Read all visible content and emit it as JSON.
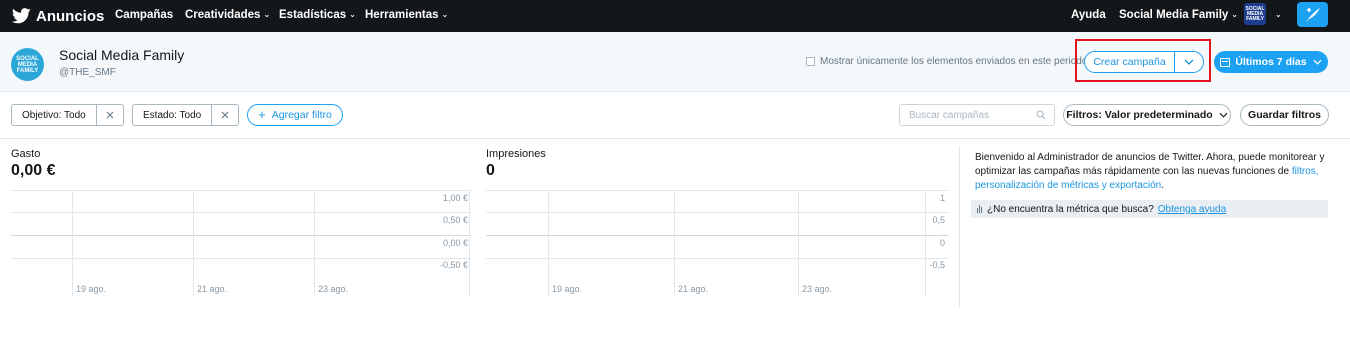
{
  "topnav": {
    "brand": "Anuncios",
    "items": [
      {
        "label": "Campañas",
        "dropdown": false
      },
      {
        "label": "Creatividades",
        "dropdown": true
      },
      {
        "label": "Estadísticas",
        "dropdown": true
      },
      {
        "label": "Herramientas",
        "dropdown": true
      }
    ],
    "help": "Ayuda",
    "account": "Social Media Family",
    "avatar_text": "SOCIAL MEDIA FAMILY",
    "colors": {
      "background": "#14171a",
      "accent": "#1da1f2"
    }
  },
  "account": {
    "name": "Social Media Family",
    "handle": "@THE_SMF",
    "avatar_text": "SOCIAL MEDIA FAMILY",
    "only_sent_label": "Mostrar únicamente los elementos enviados en este periodo",
    "only_sent_checked": false,
    "create_campaign": "Crear campaña",
    "date_range": "Últimos 7 días"
  },
  "filters": {
    "objective": "Objetivo: Todo",
    "status": "Estado: Todo",
    "add_filter": "Agregar filtro",
    "search_placeholder": "Buscar campañas",
    "filters_preset": "Filtros: Valor predeterminado",
    "save_filters": "Guardar filtros"
  },
  "metrics": {
    "spend": {
      "label": "Gasto",
      "value": "0,00 €",
      "y_ticks": [
        "1,00 €",
        "0,50 €",
        "0,00 €",
        "-0,50 €"
      ],
      "x_ticks": [
        "19 ago.",
        "21 ago.",
        "23 ago."
      ]
    },
    "impressions": {
      "label": "Impresiones",
      "value": "0",
      "y_ticks": [
        "1",
        "0,5",
        "0",
        "-0,5"
      ],
      "x_ticks": [
        "19 ago.",
        "21 ago.",
        "23 ago."
      ]
    }
  },
  "info": {
    "text": "Bienvenido al Administrador de anuncios de Twitter. Ahora, puede monitorear y optimizar las campañas más rápidamente con las nuevas funciones de ",
    "link_1": "filtros, personalización de métricas y exportación",
    "period": ".",
    "help_question": "¿No encuentra la métrica que busca?",
    "help_link": "Obtenga ayuda"
  }
}
